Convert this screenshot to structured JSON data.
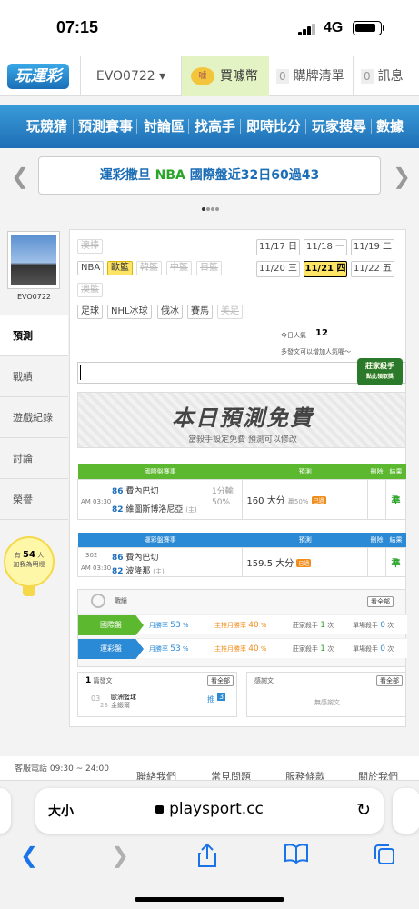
{
  "status_bar": {
    "time": "07:15",
    "network": "4G"
  },
  "top_nav": {
    "logo": "玩運彩",
    "username": "EVO0722 ▾",
    "coin_label": "買噱幣",
    "coin_icon_text": "噱",
    "cart": {
      "count": "0",
      "label": "購牌清單"
    },
    "msg": {
      "count": "0",
      "label": "訊息"
    }
  },
  "main_nav": [
    "玩競猜",
    "預測賽事",
    "討論區",
    "找高手",
    "即時比分",
    "玩家搜尋",
    "數據"
  ],
  "banner": {
    "part1": "運彩撒旦 ",
    "part2": "NBA",
    "part3": " 國際盤近32日60過43"
  },
  "profile": {
    "name": "EVO0722"
  },
  "side_menu": [
    "預測",
    "戰績",
    "遊戲紀錄",
    "討論",
    "榮譽"
  ],
  "bulb": {
    "prefix": "有",
    "count": "54",
    "suffix": "人",
    "line2": "加我為明燈"
  },
  "sports": {
    "row1": [
      {
        "label": "澳棒",
        "state": "dis"
      }
    ],
    "row2": [
      {
        "label": "NBA",
        "state": "on"
      },
      {
        "label": "歐籃",
        "state": "sel"
      },
      {
        "label": "韓籃",
        "state": "dis"
      },
      {
        "label": "中籃",
        "state": "dis"
      },
      {
        "label": "日籃",
        "state": "dis"
      }
    ],
    "row3": [
      {
        "label": "澳籃",
        "state": "dis"
      }
    ],
    "row4": [
      {
        "label": "足球",
        "state": "on"
      },
      {
        "label": "NHL冰球",
        "state": "on"
      },
      {
        "label": "俄冰",
        "state": "on"
      },
      {
        "label": "賽馬",
        "state": "on"
      },
      {
        "label": "美足",
        "state": "dis"
      }
    ]
  },
  "dates": [
    {
      "label": "11/17 日",
      "sel": false
    },
    {
      "label": "11/18 一",
      "sel": false
    },
    {
      "label": "11/19 二",
      "sel": false
    },
    {
      "label": "11/20 三",
      "sel": false
    },
    {
      "label": "11/21 四",
      "sel": true
    },
    {
      "label": "11/22 五",
      "sel": false
    }
  ],
  "popularity": {
    "label": "今日人氣",
    "value": "12",
    "hint": "多發文可以增加人氣喔～"
  },
  "stamp": {
    "line1": "莊家殺手",
    "line2": "點此領取獎"
  },
  "free": {
    "title": "本日預測免費",
    "sub": "當殺手設定免費 預測可以修改"
  },
  "intl_table": {
    "headers": [
      "國際盤賽事",
      "預測",
      "刪除",
      "結果"
    ],
    "time": "AM 03:30",
    "team1_no": "86",
    "team1": "費內巴切",
    "team2_no": "82",
    "team2": "維圖斯博洛尼亞",
    "home_mark": "(主)",
    "hint1": "1分輸",
    "hint2": "50%",
    "pick": "160 大分",
    "pick_sub": "贏50%",
    "badge": "已過",
    "result": "準"
  },
  "tw_table": {
    "headers": [
      "運彩盤賽事",
      "預測",
      "刪除",
      "結果"
    ],
    "no": "302",
    "time": "AM 03:30",
    "team1_no": "86",
    "team1": "費內巴切",
    "team2_no": "82",
    "team2": "波隆那",
    "home_mark": "(主)",
    "pick": "159.5 大分",
    "badge": "已過",
    "result": "準"
  },
  "stats": {
    "title": "戰績",
    "all_btn": "看全部",
    "rows": [
      {
        "tab": "國際盤",
        "color": "#5cb82f",
        "month_label": "月勝率",
        "month": "53",
        "main_label": "主推月勝率",
        "main": "40",
        "killer_label": "莊家殺手",
        "killer": "1",
        "single_label": "單場殺手",
        "single": "0",
        "unit": "次"
      },
      {
        "tab": "運彩盤",
        "color": "#2b8ad6",
        "month_label": "月勝率",
        "month": "53",
        "main_label": "主推月勝率",
        "main": "40",
        "killer_label": "莊家殺手",
        "killer": "1",
        "single_label": "單場殺手",
        "single": "0",
        "unit": "次"
      }
    ]
  },
  "posts": {
    "count": "1",
    "label": "篇發文",
    "btn": "看全部",
    "date_day": "03",
    "date_mon": "23",
    "title": "歐洲籃球",
    "author": "金鍛爾",
    "tag": "推",
    "tag_count": "3"
  },
  "replies": {
    "label": "感謝文",
    "btn": "看全部",
    "empty": "無感謝文"
  },
  "footer": {
    "service": "客服電話 09:30 ~ 24:00",
    "links": [
      "聯絡我們",
      "常見問題",
      "服務條款",
      "關於我們"
    ]
  },
  "browser": {
    "text_size": "大小",
    "url": "playsport.cc"
  }
}
